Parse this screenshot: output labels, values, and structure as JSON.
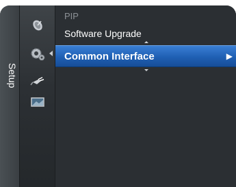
{
  "sidebar": {
    "label": "Setup"
  },
  "icons": [
    {
      "name": "satellite-dish-icon"
    },
    {
      "name": "settings-gear-icon",
      "active": true
    },
    {
      "name": "input-plug-icon"
    },
    {
      "name": "tv-picture-icon"
    }
  ],
  "menu": {
    "items": [
      {
        "label": "PIP",
        "state": "dimmed"
      },
      {
        "label": "Software Upgrade",
        "state": "normal"
      },
      {
        "label": "Common Interface",
        "state": "selected",
        "arrow": "▶"
      }
    ]
  },
  "colors": {
    "selected_bg": "#1f5fb3",
    "panel_bg": "#2b2f33",
    "dimmed_text": "#8c9196"
  }
}
